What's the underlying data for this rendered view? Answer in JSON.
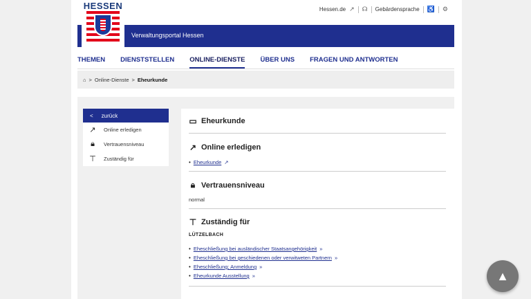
{
  "logo": {
    "text": "HESSEN"
  },
  "toplinks": {
    "hessen": "Hessen.de",
    "sign": "Gebärdensprache"
  },
  "banner": {
    "title": "Verwaltungsportal Hessen"
  },
  "nav": [
    "THEMEN",
    "DIENSTSTELLEN",
    "ONLINE-DIENSTE",
    "ÜBER UNS",
    "FRAGEN UND ANTWORTEN"
  ],
  "breadcrumb": {
    "sep": ">",
    "item1": "Online-Dienste",
    "current": "Eheurkunde"
  },
  "sidebar": {
    "back": "zurück",
    "items": [
      "Online erledigen",
      "Vertrauensniveau",
      "Zuständig für"
    ]
  },
  "content": {
    "title": "Eheurkunde",
    "online": {
      "heading": "Online erledigen",
      "link": "Eheurkunde"
    },
    "trust": {
      "heading": "Vertrauensniveau",
      "value": "normal"
    },
    "responsible": {
      "heading": "Zuständig für",
      "municipality": "LÜTZELBACH",
      "links": [
        "Eheschließung bei ausländischer Staatsangehörigkeit",
        "Eheschließung bei geschiedenen oder verwitweten Partnern",
        "Eheschließung; Anmeldung",
        "Eheurkunde Ausstellung"
      ]
    }
  }
}
